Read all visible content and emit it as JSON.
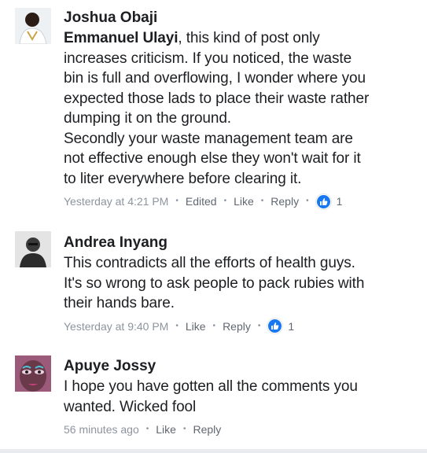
{
  "comments": [
    {
      "author": "Joshua Obaji",
      "mention": "Emmanuel Ulayi",
      "lines": [
        ", this kind of post only",
        "increases criticism. If you noticed, the waste",
        "bin is full and overflowing, I wonder where you",
        "expected those lads to place their waste rather",
        "dumping it on the ground.",
        "Secondly your waste management team are",
        "not effective enough else they won't wait for it",
        "to liter everywhere before clearing it."
      ],
      "timestamp": "Yesterday at 4:21 PM",
      "edited": "Edited",
      "like": "Like",
      "reply": "Reply",
      "reaction_count": "1",
      "reaction_icon": "thumbs-up-icon",
      "avatar_bg": "#e8ecf0"
    },
    {
      "author": "Andrea Inyang",
      "lines": [
        "This contradicts all the efforts of health guys.",
        "It's so wrong to ask people to pack rubies with",
        "their hands bare."
      ],
      "timestamp": "Yesterday at 9:40 PM",
      "like": "Like",
      "reply": "Reply",
      "reaction_count": "1",
      "reaction_icon": "thumbs-up-icon",
      "avatar_bg": "#d9d9d9"
    },
    {
      "author": "Apuye Jossy",
      "lines": [
        "I hope you have gotten all the comments you",
        "wanted. Wicked fool"
      ],
      "timestamp": "56 minutes ago",
      "like": "Like",
      "reply": "Reply",
      "avatar_bg": "#b06a8c"
    }
  ],
  "colors": {
    "text": "#1c1e21",
    "meta": "#8d949e",
    "action": "#606770",
    "reaction": "#1877f2"
  }
}
